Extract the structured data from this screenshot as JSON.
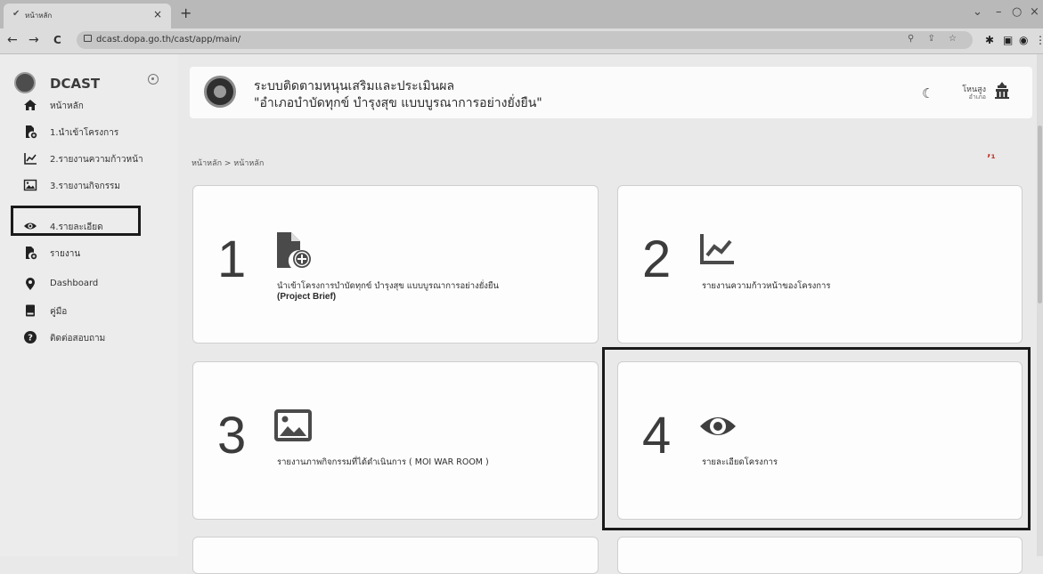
{
  "browser": {
    "tab_title": "หน้าหลัก",
    "tab_close": "×",
    "new_tab": "+",
    "url": "dcast.dopa.go.th/cast/app/main/",
    "back": "←",
    "forward": "→",
    "reload": "C",
    "window_minimize": "–",
    "window_restore": "⌄",
    "window_close": "×"
  },
  "sidebar": {
    "brand": "DCAST",
    "items": [
      {
        "label": "หน้าหลัก",
        "icon": "home-icon"
      },
      {
        "label": "1.นำเข้าโครงการ",
        "icon": "file-add-icon"
      },
      {
        "label": "2.รายงานความก้าวหน้า",
        "icon": "chart-line-icon"
      },
      {
        "label": "3.รายงานกิจกรรม",
        "icon": "image-icon"
      },
      {
        "label": "4.รายละเอียด",
        "icon": "eye-icon"
      },
      {
        "label": "รายงาน",
        "icon": "file-add-icon"
      },
      {
        "label": "Dashboard",
        "icon": "map-pin-icon"
      },
      {
        "label": "คู่มือ",
        "icon": "book-icon"
      },
      {
        "label": "ติดต่อสอบถาม",
        "icon": "question-icon"
      }
    ]
  },
  "header": {
    "title_line1": "ระบบติดตามหนุนเสริมและประเมินผล",
    "title_line2": "\"อำเภอบำบัดทุกข์ บำรุงสุข แบบบูรณาการอย่างยั่งยืน\"",
    "user_name": "โหนสูง",
    "user_role": "อำเภอ"
  },
  "breadcrumb": "หน้าหลัก > หน้าหลัก",
  "cards": [
    {
      "number": "1",
      "icon": "file-add-icon",
      "text": "นำเข้าโครงการบำบัดทุกข์ บำรุงสุข แบบบูรณาการอย่างยั่งยืน",
      "sub": "(Project Brief)"
    },
    {
      "number": "2",
      "icon": "chart-line-icon",
      "text": "รายงานความก้าวหน้าของโครงการ",
      "sub": ""
    },
    {
      "number": "3",
      "icon": "image-icon",
      "text": "รายงานภาพกิจกรรมที่ได้ดำเนินการ ( MOI WAR ROOM )",
      "sub": ""
    },
    {
      "number": "4",
      "icon": "eye-icon",
      "text": "รายละเอียดโครงการ",
      "sub": ""
    }
  ],
  "colors": {
    "page_bg": "#e9e9e9",
    "card_bg": "#fdfdfd",
    "highlight_border": "#1a1a1a"
  }
}
